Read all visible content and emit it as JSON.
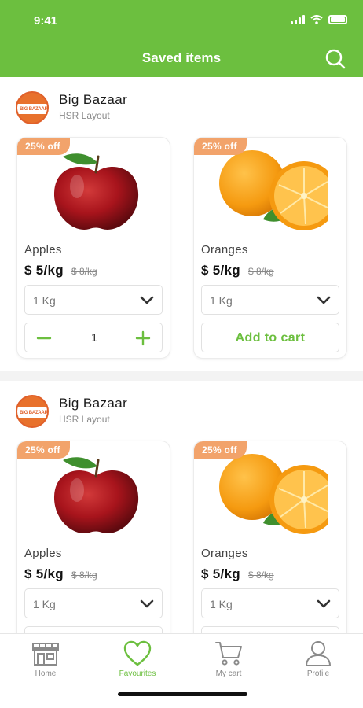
{
  "status_bar": {
    "time": "9:41"
  },
  "header": {
    "title": "Saved items"
  },
  "sections": [
    {
      "store": {
        "name": "Big Bazaar",
        "location": "HSR Layout",
        "logo_text": "BIG BAZAAR"
      },
      "products": [
        {
          "badge": "25% off",
          "name": "Apples",
          "price": "$ 5/kg",
          "old_price": "$ 8/kg",
          "quantity": "1 Kg",
          "stepper_count": "1",
          "image": "apple"
        },
        {
          "badge": "25% off",
          "name": "Oranges",
          "price": "$ 5/kg",
          "old_price": "$ 8/kg",
          "quantity": "1 Kg",
          "action_label": "Add to cart",
          "image": "orange"
        }
      ]
    },
    {
      "store": {
        "name": "Big Bazaar",
        "location": "HSR Layout",
        "logo_text": "BIG BAZAAR"
      },
      "products": [
        {
          "badge": "25% off",
          "name": "Apples",
          "price": "$ 5/kg",
          "old_price": "$ 8/kg",
          "quantity": "1 Kg",
          "image": "apple"
        },
        {
          "badge": "25% off",
          "name": "Oranges",
          "price": "$ 5/kg",
          "old_price": "$ 8/kg",
          "quantity": "1 Kg",
          "image": "orange"
        }
      ]
    }
  ],
  "tabbar": {
    "items": [
      {
        "label": "Home",
        "icon": "store-icon",
        "active": false
      },
      {
        "label": "Favourites",
        "icon": "heart-icon",
        "active": true
      },
      {
        "label": "My cart",
        "icon": "cart-icon",
        "active": false
      },
      {
        "label": "Profile",
        "icon": "profile-icon",
        "active": false
      }
    ]
  },
  "colors": {
    "brand_green": "#6cbf3f",
    "badge_orange": "#f2a36b",
    "logo_orange": "#e8712c"
  }
}
